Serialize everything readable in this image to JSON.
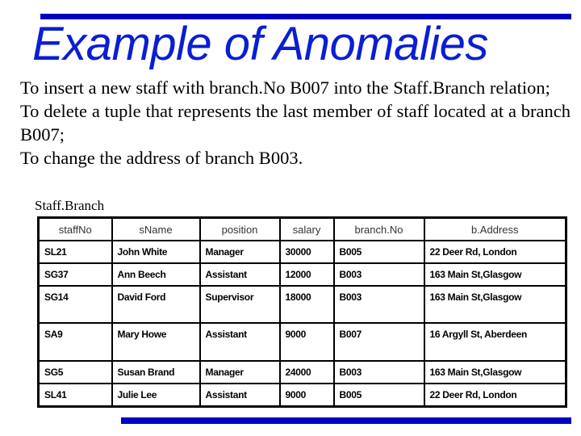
{
  "title": "Example of Anomalies",
  "body": [
    "To insert a new staff with branch.No B007 into the Staff.Branch relation;",
    "To delete a tuple that represents the last member of staff located at a branch B007;",
    "To change the address of branch B003."
  ],
  "table": {
    "caption": "Staff.Branch",
    "headers": [
      "staffNo",
      "sName",
      "position",
      "salary",
      "branch.No",
      "b.Address"
    ],
    "rows": [
      [
        "SL21",
        "John White",
        "Manager",
        "30000",
        "B005",
        "22 Deer Rd, London"
      ],
      [
        "SG37",
        "Ann Beech",
        "Assistant",
        "12000",
        "B003",
        "163 Main St,Glasgow"
      ],
      [
        "SG14",
        "David Ford",
        "Supervisor",
        "18000",
        "B003",
        "163 Main St,Glasgow"
      ],
      [
        "SA9",
        "Mary Howe",
        "Assistant",
        "9000",
        "B007",
        "16 Argyll St, Aberdeen"
      ],
      [
        "SG5",
        "Susan Brand",
        "Manager",
        "24000",
        "B003",
        "163 Main St,Glasgow"
      ],
      [
        "SL41",
        "Julie Lee",
        "Assistant",
        "9000",
        "B005",
        "22 Deer Rd, London"
      ]
    ]
  },
  "colors": {
    "accent": "#0000c0",
    "title": "#0a1ed2"
  }
}
